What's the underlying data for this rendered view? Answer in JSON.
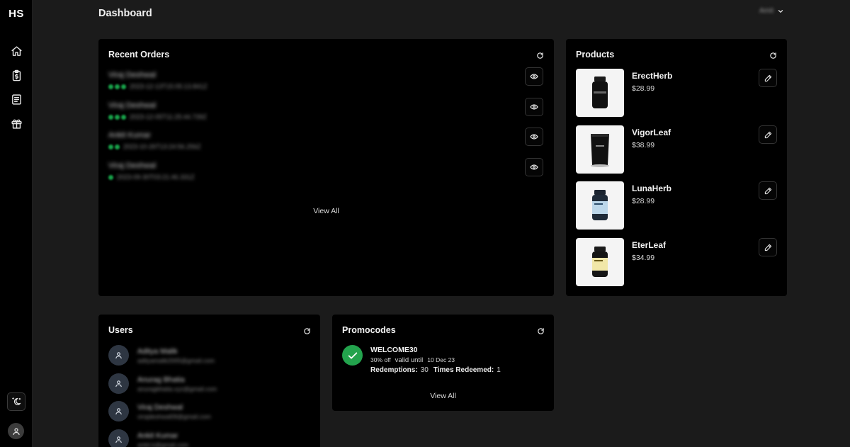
{
  "sidebar": {
    "logo": "HS",
    "items": [
      {
        "id": "home",
        "icon": "home-icon"
      },
      {
        "id": "orders",
        "icon": "clipboard-dollar-icon"
      },
      {
        "id": "products",
        "icon": "list-icon"
      },
      {
        "id": "promocodes",
        "icon": "gift-icon"
      }
    ],
    "theme_icon": "moon-sun-icon",
    "avatar_icon": "user-icon"
  },
  "header": {
    "title": "Dashboard",
    "user_name": "Amit"
  },
  "recent_orders": {
    "title": "Recent Orders",
    "orders": [
      {
        "name": "Viraj Deshwal",
        "status_count": 3,
        "date": "2023-12-13T15:05:13.841Z"
      },
      {
        "name": "Viraj Deshwal",
        "status_count": 3,
        "date": "2023-12-05T11:25:44.739Z"
      },
      {
        "name": "Ankit Kumar",
        "status_count": 2,
        "date": "2023-10-26T13:24:56.256Z"
      },
      {
        "name": "Viraj Deshwal",
        "status_count": 1,
        "date": "2023-09-30T03:21:46.331Z"
      }
    ],
    "view_all": "View All"
  },
  "products": {
    "title": "Products",
    "items": [
      {
        "name": "ErectHerb",
        "price": "$28.99",
        "kind": "bottle-black"
      },
      {
        "name": "VigorLeaf",
        "price": "$38.99",
        "kind": "pouch-black"
      },
      {
        "name": "LunaHerb",
        "price": "$28.99",
        "kind": "bottle-blue"
      },
      {
        "name": "EterLeaf",
        "price": "$34.99",
        "kind": "bottle-yellow"
      }
    ]
  },
  "users": {
    "title": "Users",
    "items": [
      {
        "name": "Aditya Malik",
        "email": "adityamalik2005@gmail.com"
      },
      {
        "name": "Anurag Bhatia",
        "email": "anuragbhatia.xyz@gmail.com"
      },
      {
        "name": "Viraj Deshwal",
        "email": "virajdeshwal09@gmail.com"
      },
      {
        "name": "Ankit Kumar",
        "email": "ankit.k@gmail.com"
      }
    ]
  },
  "promocodes": {
    "title": "Promocodes",
    "items": [
      {
        "code": "WELCOME30",
        "discount": "30% off",
        "valid_label": "valid until",
        "valid_date": "10 Dec 23",
        "redemptions_label": "Redemptions:",
        "redemptions": "30",
        "redeemed_label": "Times Redeemed:",
        "redeemed": "1"
      }
    ],
    "view_all": "View All"
  },
  "colors": {
    "background": "#1b1b1b",
    "card": "#000000",
    "success": "#23a34d",
    "avatar_bg": "#2e3642"
  }
}
